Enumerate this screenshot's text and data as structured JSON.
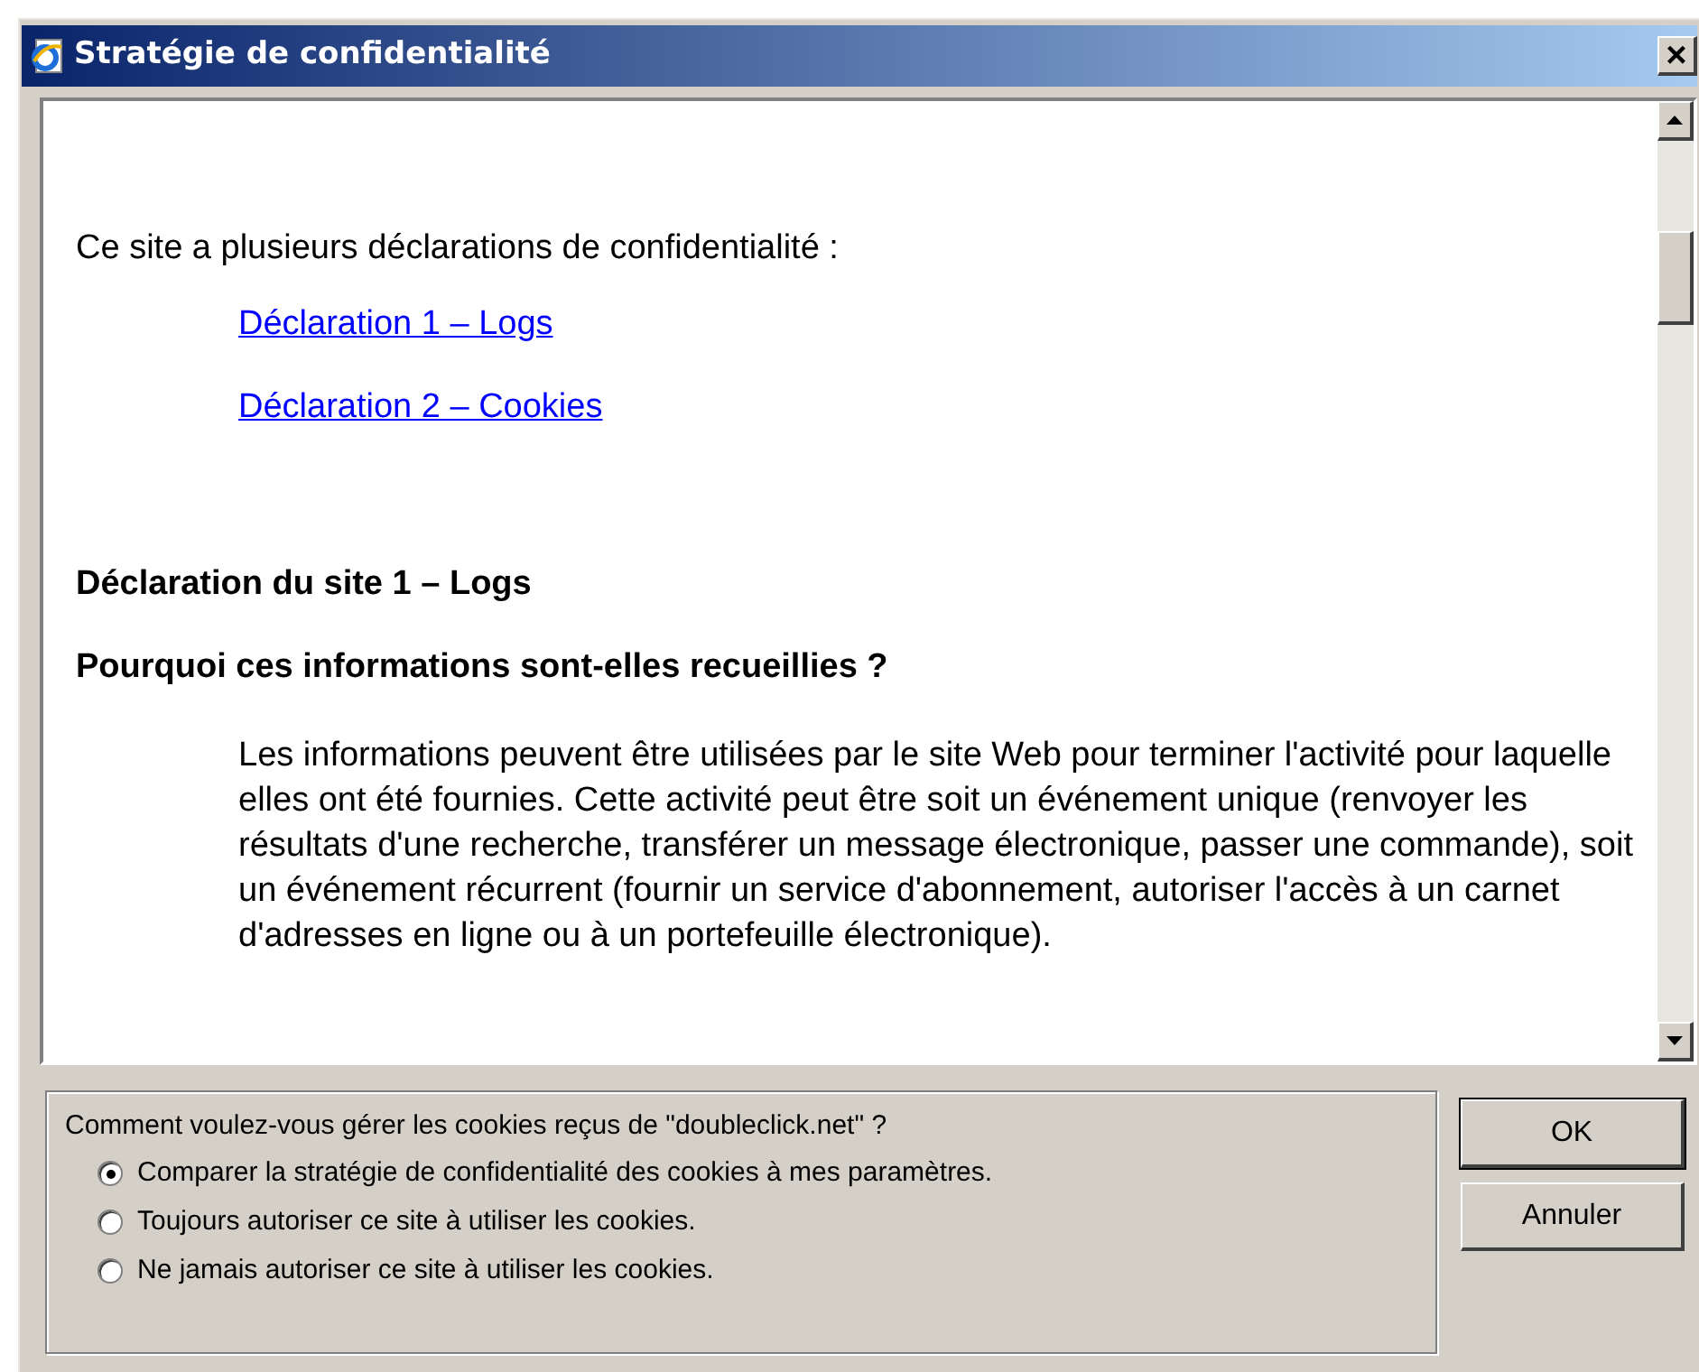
{
  "window": {
    "title": "Stratégie de confidentialité",
    "close": "×"
  },
  "content": {
    "intro": "Ce site a plusieurs déclarations de confidentialité :",
    "links": [
      "Déclaration 1 – Logs",
      "Déclaration 2 – Cookies"
    ],
    "section_title": "Déclaration du site 1 – Logs",
    "question": "Pourquoi ces informations sont-elles recueillies ?",
    "paragraph": "Les informations peuvent être utilisées par le site Web pour terminer l'activité pour laquelle elles ont été fournies. Cette activité peut être soit un événement unique (renvoyer les résultats d'une recherche, transférer un message électronique, passer une commande), soit un événement récurrent (fournir un service d'abonnement, autoriser l'accès à un carnet d'adresses en ligne ou à un portefeuille électronique)."
  },
  "cookie_choice": {
    "question": "Comment voulez-vous gérer les cookies reçus de \"doubleclick.net\" ?",
    "options": [
      {
        "label": "Comparer la stratégie de confidentialité des cookies à mes paramètres.",
        "selected": true
      },
      {
        "label": "Toujours autoriser ce site à utiliser les cookies.",
        "selected": false
      },
      {
        "label": "Ne jamais autoriser ce site à utiliser les cookies.",
        "selected": false
      }
    ]
  },
  "buttons": [
    {
      "label": "OK",
      "default": true
    },
    {
      "label": "Annuler",
      "default": false
    }
  ]
}
